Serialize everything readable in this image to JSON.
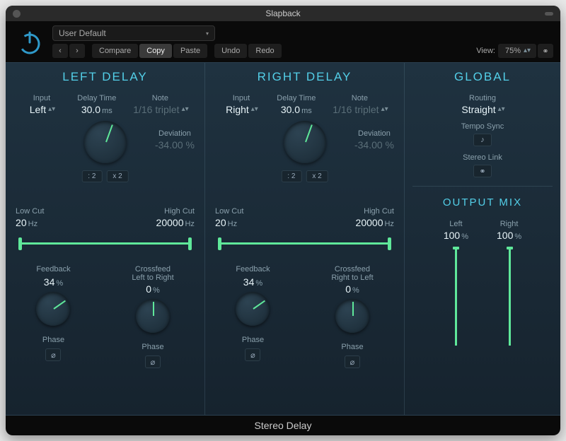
{
  "window": {
    "title": "Slapback"
  },
  "toolbar": {
    "preset": "User Default",
    "prev": "‹",
    "next": "›",
    "compare": "Compare",
    "copy": "Copy",
    "paste": "Paste",
    "undo": "Undo",
    "redo": "Redo",
    "view_label": "View:",
    "zoom": "75%"
  },
  "left": {
    "title": "LEFT DELAY",
    "input_label": "Input",
    "input": "Left",
    "delaytime_label": "Delay Time",
    "delaytime": "30.0",
    "delaytime_unit": "ms",
    "note_label": "Note",
    "note": "1/16 triplet",
    "deviation_label": "Deviation",
    "deviation": "-34.00 %",
    "half": ": 2",
    "double": "x 2",
    "lowcut_label": "Low Cut",
    "lowcut": "20",
    "lowcut_unit": "Hz",
    "highcut_label": "High Cut",
    "highcut": "20000",
    "highcut_unit": "Hz",
    "feedback_label": "Feedback",
    "feedback": "34",
    "feedback_unit": "%",
    "crossfeed_label": "Crossfeed",
    "crossfeed_sub": "Left to Right",
    "crossfeed": "0",
    "crossfeed_unit": "%",
    "phase_label": "Phase",
    "phase_sym": "⌀"
  },
  "right": {
    "title": "RIGHT DELAY",
    "input_label": "Input",
    "input": "Right",
    "delaytime_label": "Delay Time",
    "delaytime": "30.0",
    "delaytime_unit": "ms",
    "note_label": "Note",
    "note": "1/16 triplet",
    "deviation_label": "Deviation",
    "deviation": "-34.00 %",
    "half": ": 2",
    "double": "x 2",
    "lowcut_label": "Low Cut",
    "lowcut": "20",
    "lowcut_unit": "Hz",
    "highcut_label": "High Cut",
    "highcut": "20000",
    "highcut_unit": "Hz",
    "feedback_label": "Feedback",
    "feedback": "34",
    "feedback_unit": "%",
    "crossfeed_label": "Crossfeed",
    "crossfeed_sub": "Right to Left",
    "crossfeed": "0",
    "crossfeed_unit": "%",
    "phase_label": "Phase",
    "phase_sym": "⌀"
  },
  "global": {
    "title": "GLOBAL",
    "routing_label": "Routing",
    "routing": "Straight",
    "temposync_label": "Tempo Sync",
    "temposync_sym": "♪",
    "stereolink_label": "Stereo Link",
    "stereolink_sym": "⚭",
    "outputmix_title": "OUTPUT MIX",
    "left_label": "Left",
    "left": "100",
    "left_unit": "%",
    "right_label": "Right",
    "right": "100",
    "right_unit": "%"
  },
  "footer": {
    "name": "Stereo Delay"
  }
}
